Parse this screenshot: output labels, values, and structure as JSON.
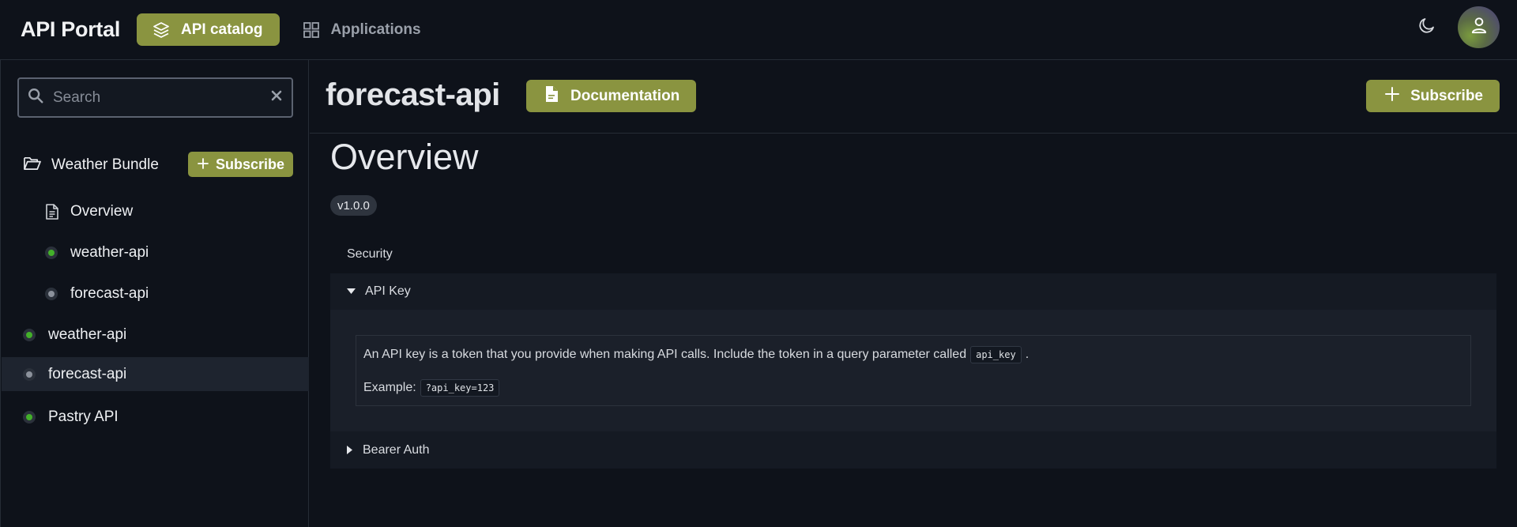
{
  "app": {
    "title": "API Portal"
  },
  "nav": {
    "catalog_label": "API catalog",
    "applications_label": "Applications"
  },
  "search": {
    "placeholder": "Search"
  },
  "sidebar": {
    "bundle": {
      "label": "Weather Bundle",
      "subscribe_label": "Subscribe"
    },
    "bundle_items": [
      {
        "label": "Overview"
      },
      {
        "label": "weather-api",
        "status": "green"
      },
      {
        "label": "forecast-api",
        "status": "gray"
      }
    ],
    "items": [
      {
        "label": "weather-api",
        "status": "green"
      },
      {
        "label": "forecast-api",
        "status": "gray",
        "selected": true
      },
      {
        "label": "Pastry API",
        "status": "green"
      }
    ]
  },
  "header": {
    "api_name": "forecast-api",
    "documentation_label": "Documentation",
    "subscribe_label": "Subscribe"
  },
  "content": {
    "heading": "Overview",
    "version": "v1.0.0",
    "security_label": "Security",
    "schemes": [
      {
        "name": "API Key",
        "expanded": true,
        "description_prefix": "An API key is a token that you provide when making API calls. Include the token in a query parameter called",
        "param": "api_key",
        "description_suffix": ".",
        "example_label": "Example:",
        "example_value": "?api_key=123"
      },
      {
        "name": "Bearer Auth",
        "expanded": false
      }
    ]
  },
  "colors": {
    "accent": "#8a9440",
    "background": "#0e121a",
    "status_green": "#43b02a",
    "status_gray": "#8c929c"
  }
}
